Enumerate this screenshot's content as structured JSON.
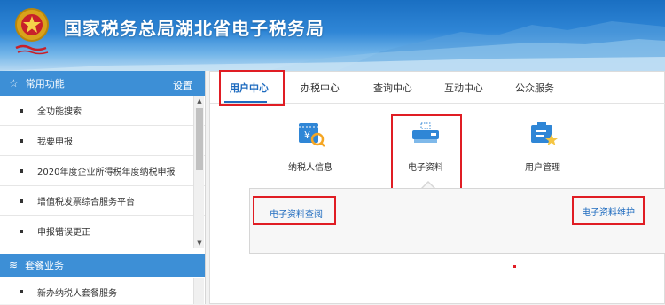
{
  "header": {
    "title": "国家税务总局湖北省电子税务局",
    "emblem_icon": "tax-emblem-icon",
    "colors": {
      "sky_top": "#1a6fc2",
      "sky_bottom": "#b7d9f2"
    }
  },
  "sidebar": {
    "common_title": "常用功能",
    "settings_label": "设置",
    "items": [
      {
        "label": "全功能搜索"
      },
      {
        "label": "我要申报"
      },
      {
        "label": "2020年度企业所得税年度纳税申报"
      },
      {
        "label": "增值税发票综合服务平台"
      },
      {
        "label": "申报错误更正"
      }
    ],
    "package_title": "套餐业务",
    "package_items": [
      {
        "label": "新办纳税人套餐服务"
      }
    ]
  },
  "main": {
    "tabs": [
      {
        "label": "用户中心",
        "active": true
      },
      {
        "label": "办税中心",
        "active": false
      },
      {
        "label": "查询中心",
        "active": false
      },
      {
        "label": "互动中心",
        "active": false
      },
      {
        "label": "公众服务",
        "active": false
      }
    ],
    "features": [
      {
        "label": "纳税人信息",
        "icon": "taxpayer-info-icon"
      },
      {
        "label": "电子资料",
        "icon": "electronic-data-icon"
      },
      {
        "label": "用户管理",
        "icon": "user-management-icon"
      }
    ],
    "sub_links": {
      "query": "电子资料查阅",
      "maintain": "电子资料维护"
    }
  },
  "colors": {
    "accent_blue": "#3d8fd6",
    "link_blue": "#1e6bbf",
    "highlight_red": "#e01d24"
  }
}
